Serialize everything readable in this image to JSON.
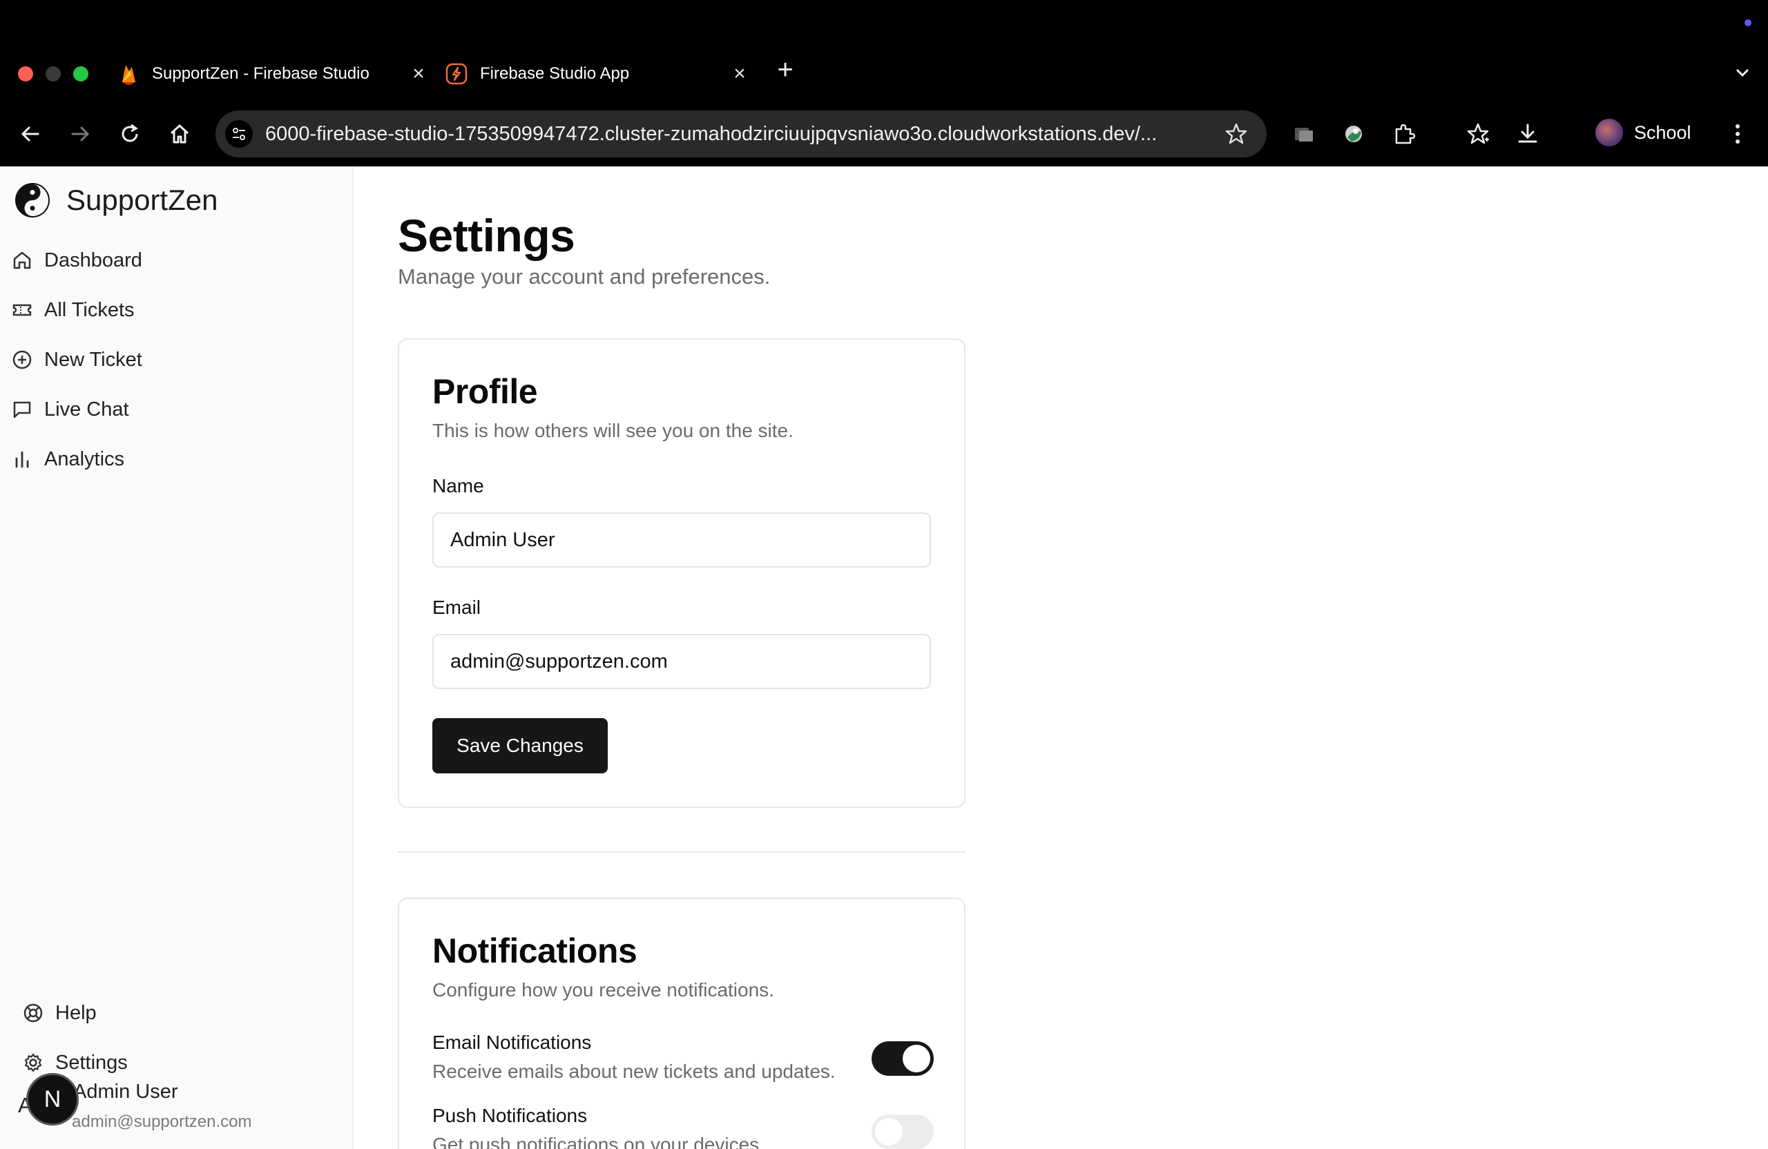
{
  "browser": {
    "tabs": [
      {
        "title": "SupportZen - Firebase Studio",
        "active": false
      },
      {
        "title": "Firebase Studio App",
        "active": true
      }
    ],
    "url": "6000-firebase-studio-1753509947472.cluster-zumahodzirciuujpqvsniawo3o.cloudworkstations.dev/...",
    "profile_name": "School"
  },
  "sidebar": {
    "brand": "SupportZen",
    "items": [
      {
        "label": "Dashboard",
        "icon": "home-icon"
      },
      {
        "label": "All Tickets",
        "icon": "ticket-icon"
      },
      {
        "label": "New Ticket",
        "icon": "plus-circle-icon"
      },
      {
        "label": "Live Chat",
        "icon": "chat-icon"
      },
      {
        "label": "Analytics",
        "icon": "bar-chart-icon"
      }
    ],
    "help": "Help",
    "settings": "Settings",
    "user": {
      "initial": "A",
      "badge": "N",
      "name": "Admin User",
      "email": "admin@supportzen.com"
    }
  },
  "page": {
    "title": "Settings",
    "subtitle": "Manage your account and preferences."
  },
  "profile": {
    "title": "Profile",
    "description": "This is how others will see you on the site.",
    "name_label": "Name",
    "name_value": "Admin User",
    "email_label": "Email",
    "email_value": "admin@supportzen.com",
    "save_label": "Save Changes"
  },
  "notifications": {
    "title": "Notifications",
    "description": "Configure how you receive notifications.",
    "items": [
      {
        "label": "Email Notifications",
        "desc": "Receive emails about new tickets and updates.",
        "enabled": true
      },
      {
        "label": "Push Notifications",
        "desc": "Get push notifications on your devices.",
        "enabled": false
      }
    ]
  }
}
